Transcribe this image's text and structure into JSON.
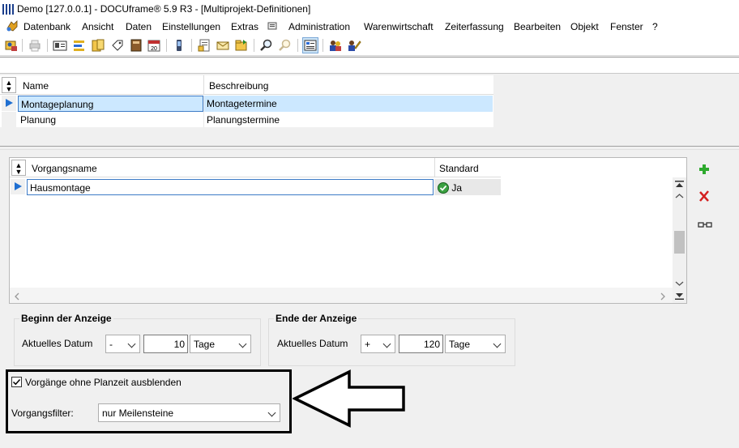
{
  "window": {
    "title": "Demo [127.0.0.1] - DOCUframe® 5.9 R3 - [Multiprojekt-Definitionen]"
  },
  "menu": {
    "items": [
      "Datenbank",
      "Ansicht",
      "Daten",
      "Einstellungen",
      "Extras",
      "Administration",
      "Warenwirtschaft",
      "Zeiterfassung",
      "Bearbeiten",
      "Objekt",
      "Fenster",
      "?"
    ]
  },
  "toolbar": {
    "icons": [
      "user-icon",
      "print-icon",
      "card-icon",
      "list-icon",
      "folder-icon",
      "tag-icon",
      "book-icon",
      "calendar-icon",
      "phone-icon",
      "document-icon",
      "mail-icon",
      "folder-open-icon",
      "search-icon",
      "search-disabled-icon",
      "view-icon",
      "users-icon",
      "users-edit-icon"
    ],
    "calendar_label": "20"
  },
  "project_grid": {
    "columns": [
      "Name",
      "Beschreibung"
    ],
    "rows": [
      {
        "name": "Montageplanung",
        "description": "Montagetermine",
        "selected": true
      },
      {
        "name": "Planung",
        "description": "Planungstermine",
        "selected": false
      }
    ]
  },
  "process_grid": {
    "columns": [
      "Vorgangsname",
      "Standard"
    ],
    "rows": [
      {
        "name": "Hausmontage",
        "standard": "Ja"
      }
    ]
  },
  "side_actions": {
    "icons": [
      "add-icon",
      "delete-icon",
      "glasses-icon"
    ]
  },
  "start_group": {
    "title": "Beginn der Anzeige",
    "label": "Aktuelles Datum",
    "sign": "-",
    "value": "10",
    "unit": "Tage"
  },
  "end_group": {
    "title": "Ende der Anzeige",
    "label": "Aktuelles Datum",
    "sign": "+",
    "value": "120",
    "unit": "Tage"
  },
  "options": {
    "hide_label": "Vorgänge ohne Planzeit ausblenden",
    "hide_checked": true,
    "filter_label": "Vorgangsfilter:",
    "filter_value": "nur Meilensteine"
  },
  "colors": {
    "selection": "#cce8ff",
    "accent": "#1f6fd1",
    "add": "#2eaa2e",
    "delete": "#d42020"
  }
}
